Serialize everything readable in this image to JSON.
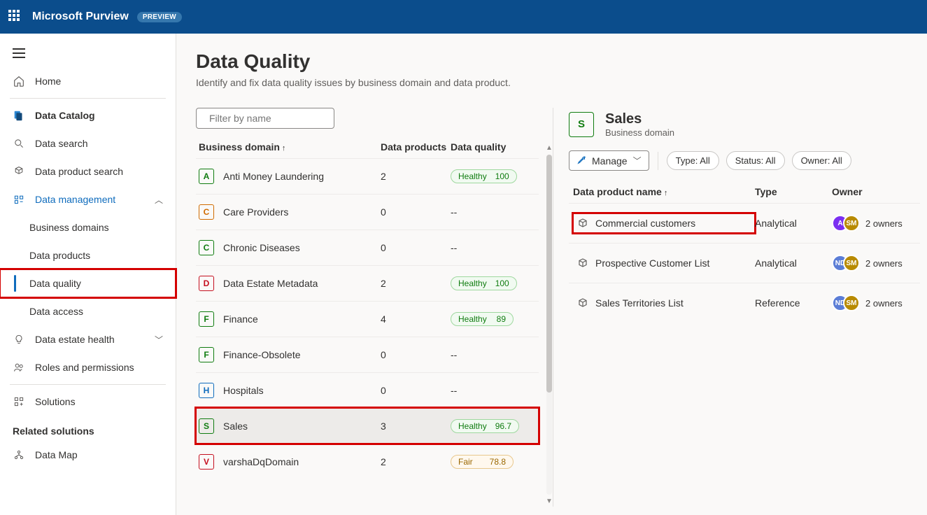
{
  "header": {
    "brand": "Microsoft Purview",
    "preview": "PREVIEW"
  },
  "sidebar": {
    "home": "Home",
    "catalog_section": "Data Catalog",
    "search": "Data search",
    "product_search": "Data product search",
    "data_mgmt": "Data management",
    "business_domains": "Business domains",
    "data_products": "Data products",
    "data_quality": "Data quality",
    "data_access": "Data access",
    "estate_health": "Data estate health",
    "roles": "Roles and permissions",
    "solutions": "Solutions",
    "related": "Related solutions",
    "data_map": "Data Map"
  },
  "page": {
    "title": "Data Quality",
    "subtitle": "Identify and fix data quality issues by business domain and data product.",
    "filter_placeholder": "Filter by name",
    "col_domain": "Business domain",
    "col_products": "Data products",
    "col_quality": "Data quality"
  },
  "domains": [
    {
      "letter": "A",
      "cls": "letter-green",
      "name": "Anti Money Laundering",
      "products": "2",
      "status": "Healthy",
      "score": "100",
      "pill": "pill-healthy"
    },
    {
      "letter": "C",
      "cls": "letter-orange",
      "name": "Care Providers",
      "products": "0",
      "status": "--",
      "score": "",
      "pill": ""
    },
    {
      "letter": "C",
      "cls": "letter-green",
      "name": "Chronic Diseases",
      "products": "0",
      "status": "--",
      "score": "",
      "pill": ""
    },
    {
      "letter": "D",
      "cls": "letter-red",
      "name": "Data Estate Metadata",
      "products": "2",
      "status": "Healthy",
      "score": "100",
      "pill": "pill-healthy"
    },
    {
      "letter": "F",
      "cls": "letter-green",
      "name": "Finance",
      "products": "4",
      "status": "Healthy",
      "score": "89",
      "pill": "pill-healthy"
    },
    {
      "letter": "F",
      "cls": "letter-green",
      "name": "Finance-Obsolete",
      "products": "0",
      "status": "--",
      "score": "",
      "pill": ""
    },
    {
      "letter": "H",
      "cls": "letter-blue",
      "name": "Hospitals",
      "products": "0",
      "status": "--",
      "score": "",
      "pill": ""
    },
    {
      "letter": "S",
      "cls": "letter-green",
      "name": "Sales",
      "products": "3",
      "status": "Healthy",
      "score": "96.7",
      "pill": "pill-healthy",
      "selected": true,
      "highlight": true
    },
    {
      "letter": "V",
      "cls": "letter-red",
      "name": "varshaDqDomain",
      "products": "2",
      "status": "Fair",
      "score": "78.8",
      "pill": "pill-fair"
    }
  ],
  "detail": {
    "letter": "S",
    "title": "Sales",
    "subtitle": "Business domain",
    "manage": "Manage",
    "filter_type": "Type: All",
    "filter_status": "Status: All",
    "filter_owner": "Owner: All",
    "col_name": "Data product name",
    "col_type": "Type",
    "col_owner": "Owner",
    "products": [
      {
        "name": "Commercial customers",
        "type": "Analytical",
        "av1": "A",
        "av1c": "av-purple",
        "av2": "SM",
        "av2c": "av-brown",
        "owners": "2 owners",
        "highlight": true
      },
      {
        "name": "Prospective Customer List",
        "type": "Analytical",
        "av1": "ND",
        "av1c": "av-blue",
        "av2": "SM",
        "av2c": "av-brown",
        "owners": "2 owners"
      },
      {
        "name": "Sales Territories List",
        "type": "Reference",
        "av1": "ND",
        "av1c": "av-blue",
        "av2": "SM",
        "av2c": "av-brown",
        "owners": "2 owners"
      }
    ]
  }
}
